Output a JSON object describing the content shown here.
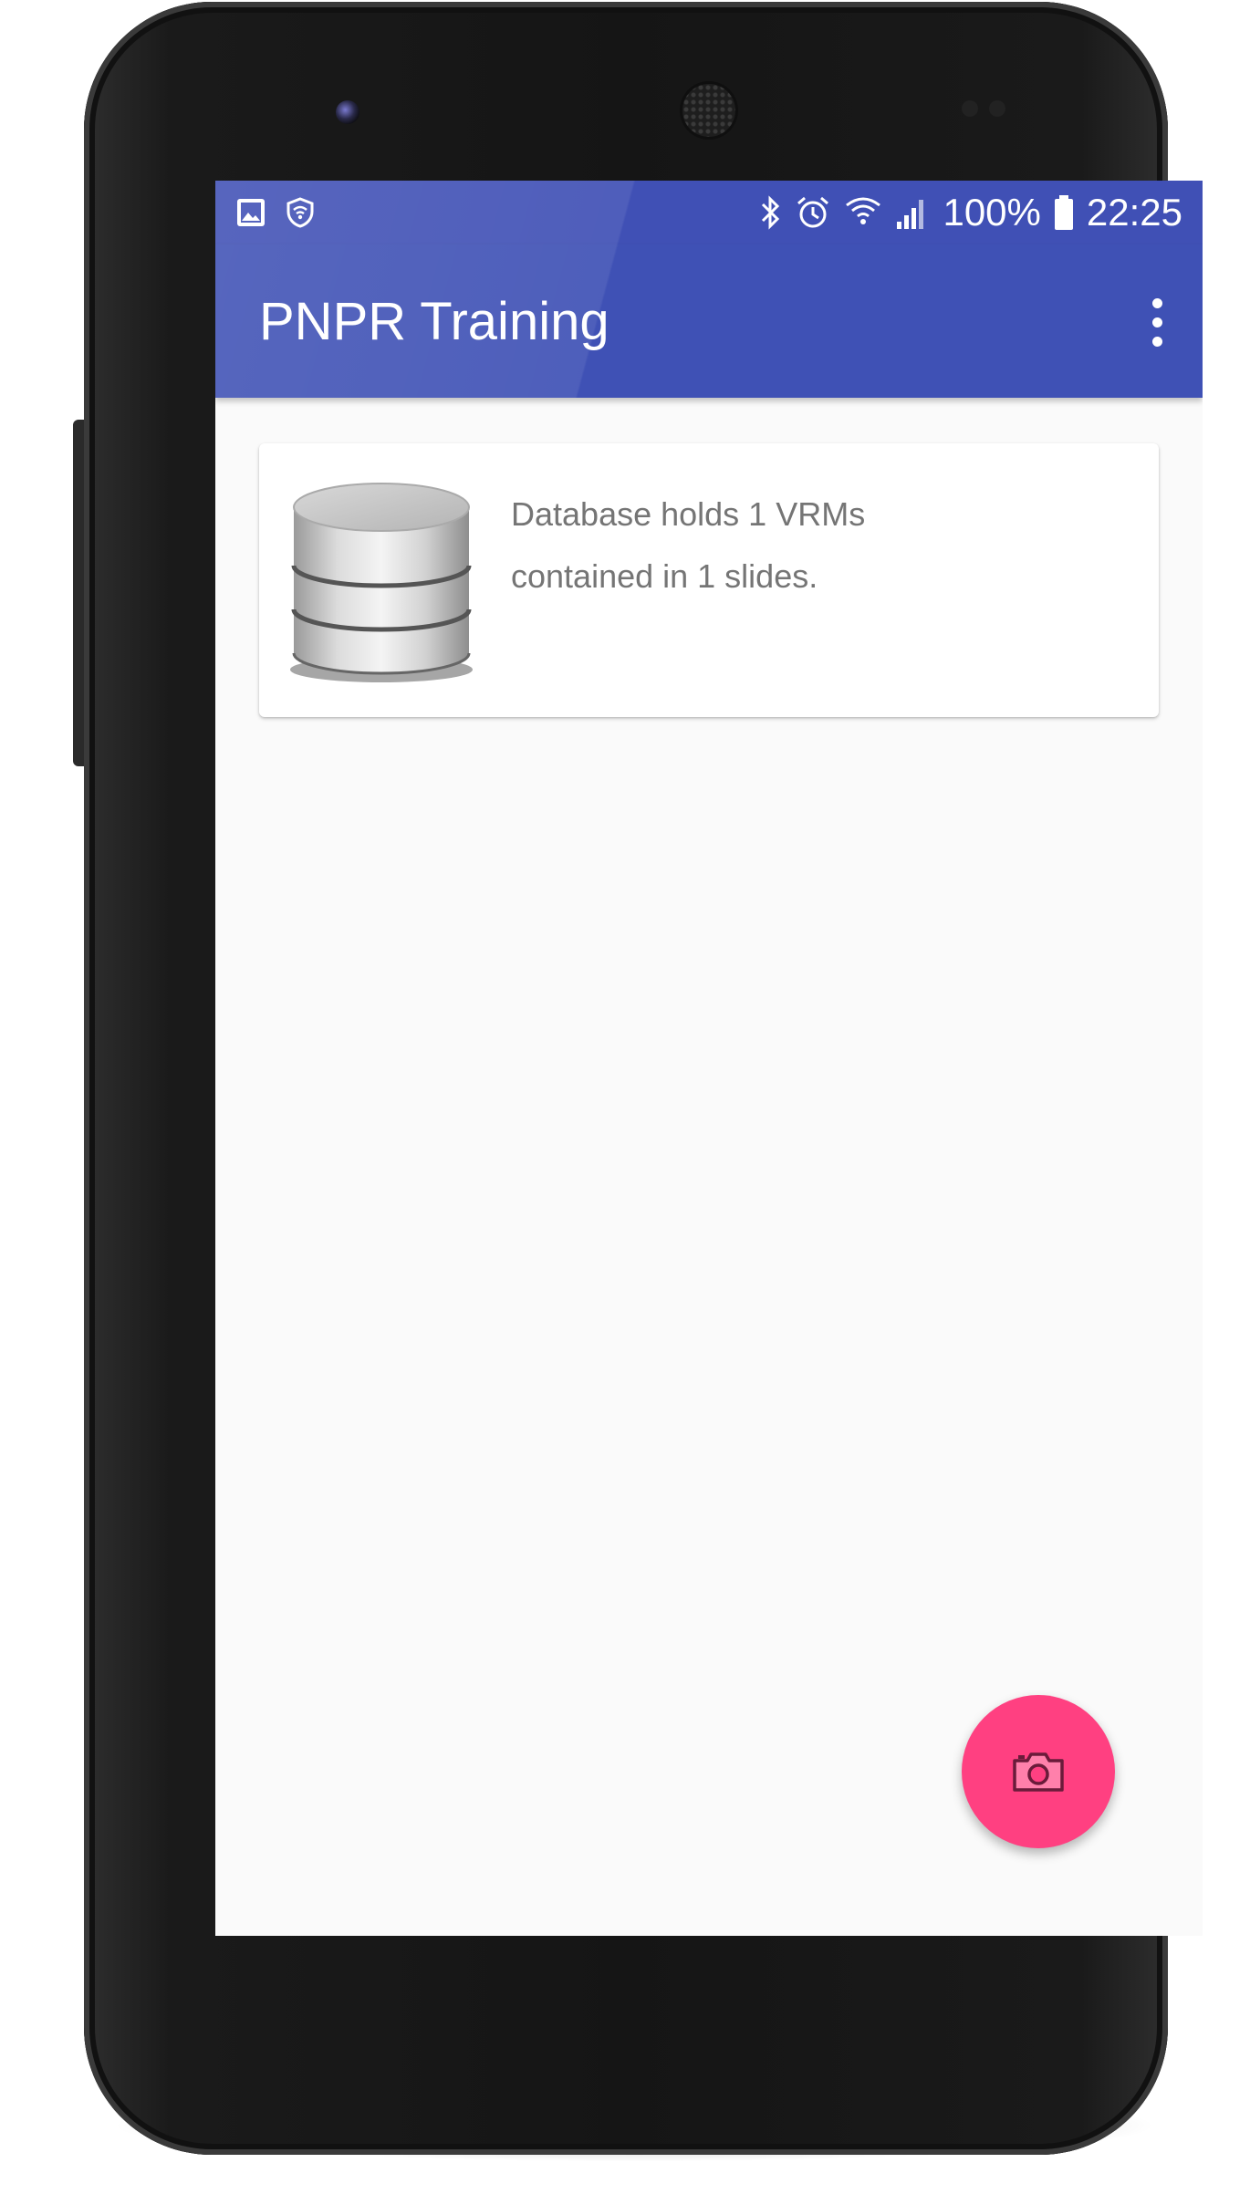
{
  "status_bar": {
    "battery_percent": "100%",
    "time": "22:25",
    "icons": [
      "image-icon",
      "vpn-shield-icon",
      "bluetooth-icon",
      "alarm-icon",
      "wifi-icon",
      "cell-signal-icon",
      "battery-icon"
    ]
  },
  "app_bar": {
    "title": "PNPR Training",
    "menu_icon": "overflow-menu-icon"
  },
  "card": {
    "icon": "database-icon",
    "line1": "Database holds 1 VRMs",
    "line2": "contained in 1 slides."
  },
  "fab": {
    "icon": "camera-icon"
  },
  "colors": {
    "primary": "#3f51b5",
    "status_bar": "#4050b5",
    "accent": "#ff4081",
    "background": "#fafafa",
    "text_secondary": "#757575"
  }
}
